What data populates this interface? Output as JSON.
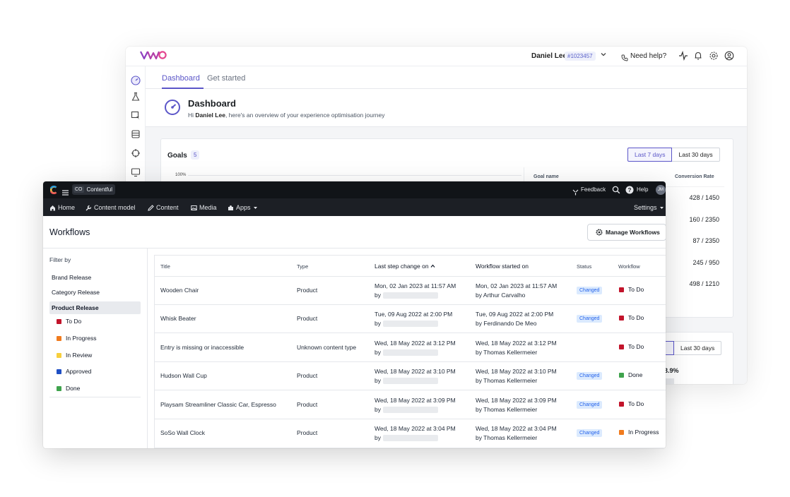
{
  "vwo": {
    "logo": "VWO",
    "user_name": "Daniel Lee",
    "account_id": "#1023457",
    "help_label": "Need help?",
    "tabs": [
      "Dashboard",
      "Get started"
    ],
    "dashboard_title": "Dashboard",
    "greeting_prefix": "Hi",
    "greeting_name": "Daniel Lee",
    "greeting_suffix": ", here's an overview of your experience optimisation journey",
    "goals_label": "Goals",
    "goals_count": "5",
    "range_7": "Last 7 days",
    "range_30": "Last 30 days",
    "axis_top": "100%",
    "col_goal": "Goal name",
    "col_conv": "Conversion Rate",
    "conversions": [
      "428 / 1450",
      "160 / 2350",
      "87 / 2350",
      "245 / 950",
      "498 / 1210"
    ],
    "card2_range_30": "Last 30 days",
    "card2_pct": "3.9%"
  },
  "contentful": {
    "space_code": "CO",
    "space_name": "Contentful",
    "feedback": "Feedback",
    "help": "Help",
    "avatar": "JM",
    "nav": {
      "home": "Home",
      "content_model": "Content model",
      "content": "Content",
      "media": "Media",
      "apps": "Apps",
      "settings": "Settings"
    },
    "page_title": "Workflows",
    "manage_button": "Manage Workflows",
    "filter_title": "Filter by",
    "filters": [
      "Brand Release",
      "Category Release",
      "Product Release"
    ],
    "statuses": [
      {
        "label": "To Do",
        "color": "#c2142b"
      },
      {
        "label": "In Progress",
        "color": "#f07b1e"
      },
      {
        "label": "In Review",
        "color": "#f7cf3d"
      },
      {
        "label": "Approved",
        "color": "#1f4fc4"
      },
      {
        "label": "Done",
        "color": "#3fa34d"
      }
    ],
    "columns": {
      "title": "Title",
      "type": "Type",
      "last_step": "Last step change on",
      "started": "Workflow started on",
      "status": "Status",
      "workflow": "Workflow"
    },
    "rows": [
      {
        "title": "Wooden Chair",
        "type": "Product",
        "last": "Mon, 02 Jan 2023 at 11:57 AM",
        "last_by": "by",
        "started": "Mon, 02 Jan 2023 at 11:57 AM",
        "started_by": "by Arthur Carvalho",
        "status": "Changed",
        "workflow": "To Do",
        "wf_color": "#c2142b"
      },
      {
        "title": "Whisk Beater",
        "type": "Product",
        "last": "Tue, 09 Aug 2022 at 2:00 PM",
        "last_by": "by",
        "started": "Tue, 09 Aug 2022 at 2:00 PM",
        "started_by": "by Ferdinando De Meo",
        "status": "Changed",
        "workflow": "To Do",
        "wf_color": "#c2142b"
      },
      {
        "title": "Entry is missing or inaccessible",
        "type": "Unknown content type",
        "last": "Wed, 18 May 2022 at 3:12 PM",
        "last_by": "by",
        "started": "Wed, 18 May 2022 at 3:12 PM",
        "started_by": "by Thomas Kellermeier",
        "status": "",
        "workflow": "To Do",
        "wf_color": "#c2142b"
      },
      {
        "title": "Hudson Wall Cup",
        "type": "Product",
        "last": "Wed, 18 May 2022 at 3:10 PM",
        "last_by": "by",
        "started": "Wed, 18 May 2022 at 3:10 PM",
        "started_by": "by Thomas Kellermeier",
        "status": "Changed",
        "workflow": "Done",
        "wf_color": "#3fa34d"
      },
      {
        "title": "Playsam Streamliner Classic Car, Espresso",
        "type": "Product",
        "last": "Wed, 18 May 2022 at 3:09 PM",
        "last_by": "by",
        "started": "Wed, 18 May 2022 at 3:09 PM",
        "started_by": "by Thomas Kellermeier",
        "status": "Changed",
        "workflow": "To Do",
        "wf_color": "#c2142b"
      },
      {
        "title": "SoSo Wall Clock",
        "type": "Product",
        "last": "Wed, 18 May 2022 at 3:04 PM",
        "last_by": "by",
        "started": "Wed, 18 May 2022 at 3:04 PM",
        "started_by": "by Thomas Kellermeier",
        "status": "Changed",
        "workflow": "In Progress",
        "wf_color": "#f07b1e"
      }
    ]
  }
}
